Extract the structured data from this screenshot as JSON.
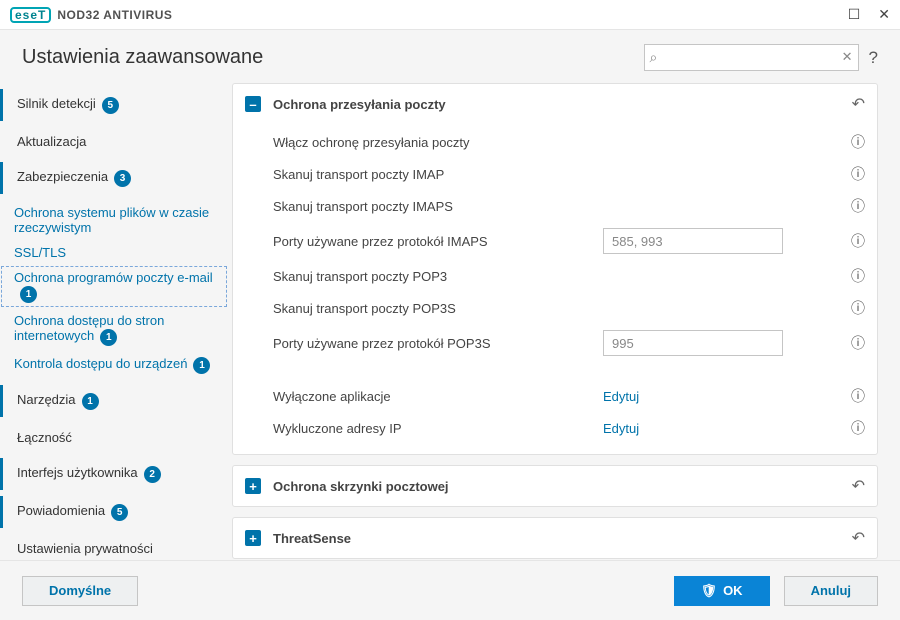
{
  "titlebar": {
    "brand_prefix": "eseT",
    "brand_text": "NOD32 ANTIVIRUS"
  },
  "page_title": "Ustawienia zaawansowane",
  "search": {
    "placeholder": ""
  },
  "sidebar": [
    {
      "label": "Silnik detekcji",
      "badge": "5",
      "type": "main",
      "active": true
    },
    {
      "label": "Aktualizacja",
      "type": "main"
    },
    {
      "label": "Zabezpieczenia",
      "badge": "3",
      "type": "main",
      "active": true
    },
    {
      "label": "Ochrona systemu plików w czasie rzeczywistym",
      "type": "sub"
    },
    {
      "label": "SSL/TLS",
      "type": "sub"
    },
    {
      "label": "Ochrona programów poczty e-mail",
      "badge": "1",
      "type": "sub",
      "selected": true
    },
    {
      "label": "Ochrona dostępu do stron internetowych",
      "badge": "1",
      "type": "sub"
    },
    {
      "label": "Kontrola dostępu do urządzeń",
      "badge": "1",
      "type": "sub"
    },
    {
      "label": "Narzędzia",
      "badge": "1",
      "type": "main",
      "active": true
    },
    {
      "label": "Łączność",
      "type": "main"
    },
    {
      "label": "Interfejs użytkownika",
      "badge": "2",
      "type": "main",
      "active": true
    },
    {
      "label": "Powiadomienia",
      "badge": "5",
      "type": "main",
      "active": true
    },
    {
      "label": "Ustawienia prywatności",
      "type": "main"
    }
  ],
  "panels": [
    {
      "title": "Ochrona przesyłania poczty",
      "expanded": true,
      "rows": [
        {
          "label": "Włącz ochronę przesyłania poczty",
          "control": "toggle"
        },
        {
          "label": "Skanuj transport poczty IMAP",
          "control": "toggle"
        },
        {
          "label": "Skanuj transport poczty IMAPS",
          "control": "toggle"
        },
        {
          "label": "Porty używane przez protokół IMAPS",
          "control": "input",
          "value": "585, 993"
        },
        {
          "label": "Skanuj transport poczty POP3",
          "control": "toggle"
        },
        {
          "label": "Skanuj transport poczty POP3S",
          "control": "toggle"
        },
        {
          "label": "Porty używane przez protokół POP3S",
          "control": "input",
          "value": "995"
        },
        {
          "label": "",
          "control": "spacer"
        },
        {
          "label": "Wyłączone aplikacje",
          "control": "link",
          "link_text": "Edytuj"
        },
        {
          "label": "Wykluczone adresy IP",
          "control": "link",
          "link_text": "Edytuj"
        }
      ]
    },
    {
      "title": "Ochrona skrzynki pocztowej",
      "expanded": false
    },
    {
      "title": "ThreatSense",
      "expanded": false
    }
  ],
  "footer": {
    "default_btn": "Domyślne",
    "ok_btn": "OK",
    "cancel_btn": "Anuluj"
  }
}
